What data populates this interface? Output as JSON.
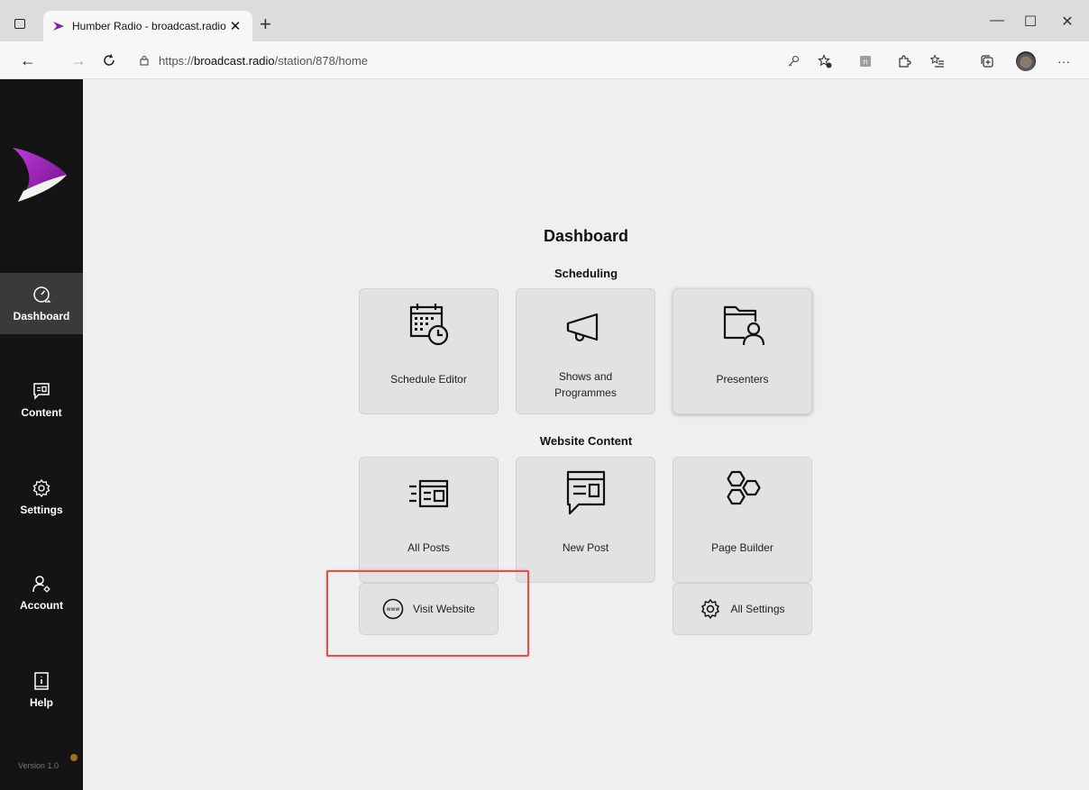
{
  "browser": {
    "tab_title": "Humber Radio - broadcast.radio",
    "url_prefix": "https://",
    "url_host": "broadcast.radio",
    "url_path": "/station/878/home",
    "new_tab_label": "+",
    "minimize_label": "—",
    "maximize_label": "☐",
    "close_label": "✕"
  },
  "sidebar": {
    "items": [
      {
        "label": "Dashboard",
        "icon": "dashboard-gauge-icon",
        "active": true
      },
      {
        "label": "Content",
        "icon": "content-chat-icon",
        "active": false
      },
      {
        "label": "Settings",
        "icon": "gear-icon",
        "active": false
      },
      {
        "label": "Account",
        "icon": "account-user-gear-icon",
        "active": false
      },
      {
        "label": "Help",
        "icon": "info-book-icon",
        "active": false
      }
    ],
    "version": "Version 1.0"
  },
  "main": {
    "title": "Dashboard",
    "scheduling": {
      "heading": "Scheduling",
      "cards": [
        {
          "label": "Schedule Editor",
          "icon": "calendar-clock-icon"
        },
        {
          "label_line1": "Shows and",
          "label_line2": "Programmes",
          "icon": "megaphone-icon"
        },
        {
          "label": "Presenters",
          "icon": "folder-person-icon"
        }
      ]
    },
    "website": {
      "heading": "Website Content",
      "cards": [
        {
          "label": "All Posts",
          "icon": "list-document-icon"
        },
        {
          "label": "New Post",
          "icon": "chat-document-icon"
        },
        {
          "label": "Page Builder",
          "icon": "hexagons-icon"
        }
      ]
    },
    "links": {
      "visit_website": "Visit Website",
      "visit_icon_text": "www",
      "all_settings": "All Settings"
    }
  },
  "colors": {
    "sidebar_bg": "#141414",
    "active_item_bg": "#3a3a3a",
    "main_bg": "#efefef",
    "card_bg": "#e2e2e2",
    "highlight": "#e05050",
    "logo_purple": "#8b1fa8"
  }
}
